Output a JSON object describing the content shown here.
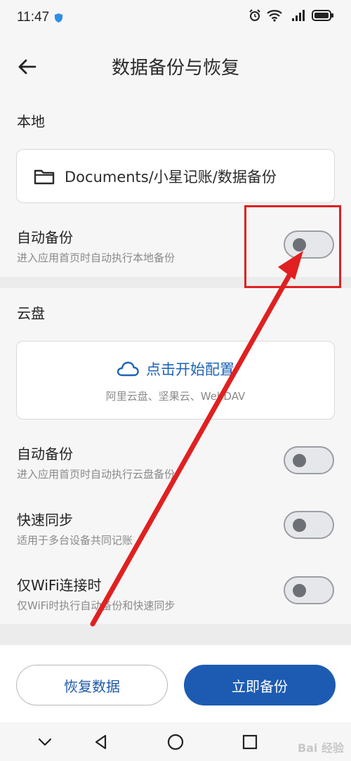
{
  "status_bar": {
    "time": "11:47"
  },
  "header": {
    "title": "数据备份与恢复"
  },
  "local": {
    "section_title": "本地",
    "path": "Documents/小星记账/数据备份",
    "auto_backup": {
      "title": "自动备份",
      "subtitle": "进入应用首页时自动执行本地备份",
      "enabled": false
    }
  },
  "cloud": {
    "section_title": "云盘",
    "configure_label": "点击开始配置",
    "providers": "阿里云盘、坚果云、WebDAV",
    "auto_backup": {
      "title": "自动备份",
      "subtitle": "进入应用首页时自动执行云盘备份",
      "enabled": false
    },
    "quick_sync": {
      "title": "快速同步",
      "subtitle": "适用于多台设备共同记账",
      "enabled": false
    },
    "wifi_only": {
      "title": "仅WiFi连接时",
      "subtitle": "仅WiFi时执行自动备份和快速同步",
      "enabled": false
    }
  },
  "actions": {
    "restore_label": "恢复数据",
    "backup_label": "立即备份"
  },
  "colors": {
    "accent": "#1d5bb2",
    "link": "#1e63b8",
    "annotation_red": "#e02020"
  },
  "watermark": "Bai 经验"
}
